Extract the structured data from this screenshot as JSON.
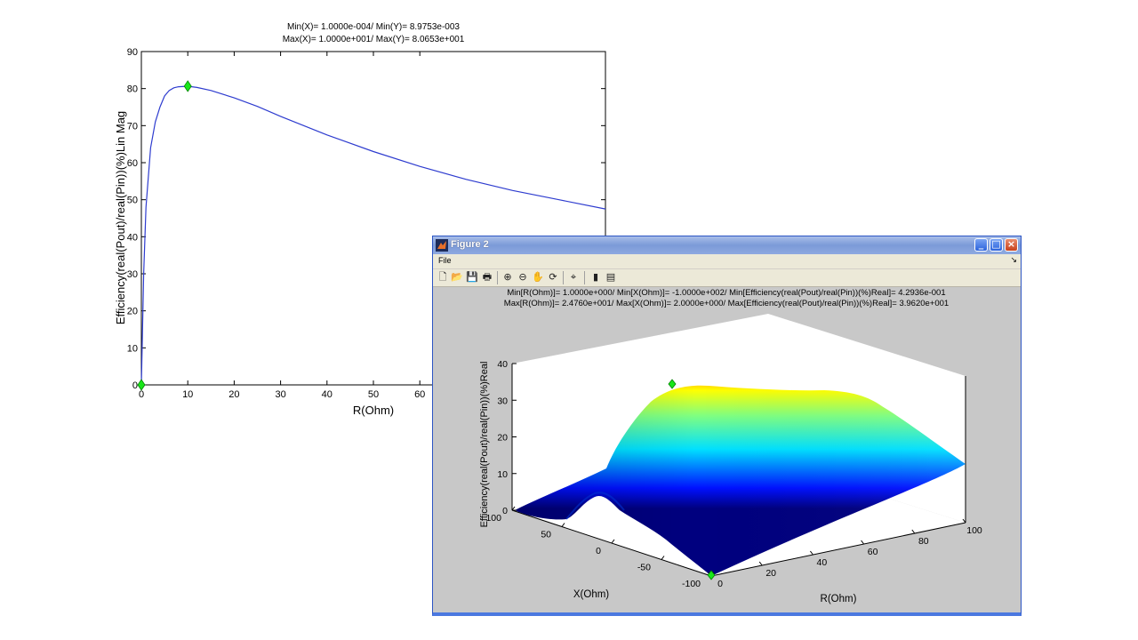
{
  "plot2d": {
    "header_line1": "Min(X)= 1.0000e-004/ Min(Y)= 8.9753e-003",
    "header_line2": "Max(X)= 1.0000e+001/ Max(Y)= 8.0653e+001",
    "xlabel": "R(Ohm)",
    "ylabel": "Efficiency(real(Pout)/real(Pin))(%)Lin Mag",
    "line_color": "#2e3ccf",
    "marker_color": "#19e619"
  },
  "figure2": {
    "window_title": "Figure 2",
    "menu": [
      "File"
    ],
    "header_line1": "Min[R(Ohm)]= 1.0000e+000/ Min[X(Ohm)]= -1.0000e+002/ Min[Efficiency(real(Pout)/real(Pin))(%)Real]= 4.2936e-001",
    "header_line2": "Max[R(Ohm)]= 2.4760e+001/ Max[X(Ohm)]= 2.0000e+000/ Max[Efficiency(real(Pout)/real(Pin))(%)Real]= 3.9620e+001",
    "zlabel": "Efficiency(real(Pout)/real(Pin))(%)Real",
    "xlabel": "X(Ohm)",
    "rlabel": "R(Ohm)",
    "z_ticks": [
      "0",
      "10",
      "20",
      "30",
      "40"
    ],
    "x_ticks": [
      "100",
      "50",
      "0",
      "-50",
      "-100"
    ],
    "r_ticks": [
      "0",
      "20",
      "40",
      "60",
      "80",
      "100"
    ],
    "toolbar_icons": [
      "new-file-icon",
      "open-folder-icon",
      "save-icon",
      "print-icon",
      "zoom-in-icon",
      "zoom-out-icon",
      "pan-hand-icon",
      "rotate-3d-icon",
      "data-cursor-icon",
      "colorbar-icon",
      "legend-icon"
    ]
  },
  "chart_data": [
    {
      "type": "line",
      "title": "Min(X)= 1.0000e-004/ Min(Y)= 8.9753e-003 / Max(X)= 1.0000e+001/ Max(Y)= 8.0653e+001",
      "xlabel": "R(Ohm)",
      "ylabel": "Efficiency(real(Pout)/real(Pin))(%)Lin Mag",
      "xlim": [
        0,
        100
      ],
      "ylim": [
        0,
        90
      ],
      "x_ticks": [
        "0",
        "10",
        "20",
        "30",
        "40",
        "50",
        "60"
      ],
      "y_ticks": [
        "0",
        "10",
        "20",
        "30",
        "40",
        "50",
        "60",
        "70",
        "80",
        "90"
      ],
      "series": [
        {
          "x": [
            0.0001,
            0.5,
            1,
            2,
            3,
            4,
            5,
            6,
            7,
            8,
            10,
            12,
            15,
            20,
            25,
            30,
            40,
            50,
            60,
            70,
            80,
            90,
            100
          ],
          "values": [
            0.009,
            30,
            48,
            64,
            71,
            75,
            78,
            79.5,
            80.2,
            80.5,
            80.65,
            80.3,
            79.5,
            77.5,
            75.2,
            72.5,
            67.5,
            63,
            59,
            55.5,
            52.5,
            50,
            47.5
          ]
        }
      ],
      "markers": [
        {
          "x": 0.0001,
          "y": 0.009
        },
        {
          "x": 10,
          "y": 80.653
        }
      ],
      "grid": false
    },
    {
      "type": "surface",
      "xlabel": "X(Ohm)",
      "ylabel": "R(Ohm)",
      "zlabel": "Efficiency(real(Pout)/real(Pin))(%)Real",
      "xlim": [
        -100,
        100
      ],
      "ylim": [
        0,
        100
      ],
      "zlim": [
        0,
        40
      ],
      "colormap": "jet",
      "min_point": {
        "r": 1,
        "x": -100,
        "z": 0.43
      },
      "max_point": {
        "r": 24.76,
        "x": 2,
        "z": 39.62
      }
    }
  ]
}
